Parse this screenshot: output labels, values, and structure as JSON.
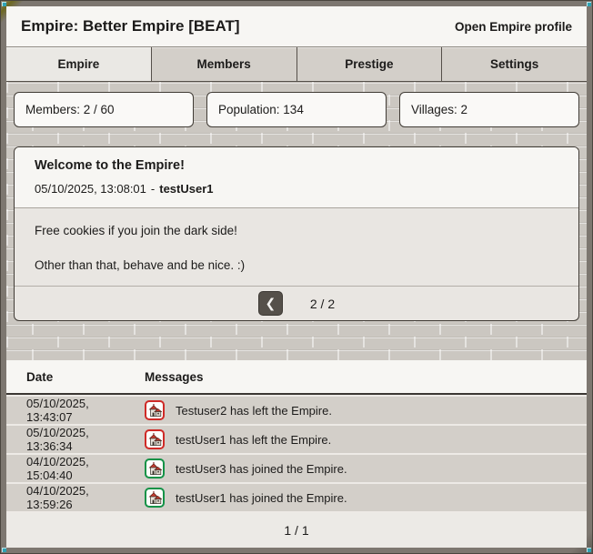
{
  "window": {
    "title": "Empire: Better Empire [BEAT]",
    "profile_link": "Open Empire profile"
  },
  "tabs": [
    {
      "label": "Empire",
      "active": true
    },
    {
      "label": "Members",
      "active": false
    },
    {
      "label": "Prestige",
      "active": false
    },
    {
      "label": "Settings",
      "active": false
    }
  ],
  "stats": [
    {
      "label": "Members: 2 / 60"
    },
    {
      "label": "Population: 134"
    },
    {
      "label": "Villages: 2"
    }
  ],
  "announcement": {
    "title": "Welcome to the Empire!",
    "timestamp": "05/10/2025, 13:08:01",
    "separator": "-",
    "author": "testUser1",
    "line1": "Free cookies if you join the dark side!",
    "line2": "Other than that, behave and be nice. :)",
    "pagination": {
      "prev_icon": "❮",
      "page": "2 / 2"
    }
  },
  "log": {
    "columns": {
      "date": "Date",
      "messages": "Messages"
    },
    "rows": [
      {
        "date": "05/10/2025, 13:43:07",
        "variant": "left",
        "text": "Testuser2 has left the Empire."
      },
      {
        "date": "05/10/2025, 13:36:34",
        "variant": "left",
        "text": "testUser1 has left the Empire."
      },
      {
        "date": "04/10/2025, 15:04:40",
        "variant": "joined",
        "text": "testUser3 has joined the Empire."
      },
      {
        "date": "04/10/2025, 13:59:26",
        "variant": "joined",
        "text": "testUser1 has joined the Empire."
      }
    ],
    "pagination": "1 / 1"
  },
  "colors": {
    "left_event_border": "#cf2a27",
    "joined_event_border": "#149247",
    "frame": "#7d7770",
    "resize_handle": "#2fa3b4",
    "brick_background": "#cbc7c1",
    "panel_background": "#f7f6f3",
    "row_background": "#d3cfc9",
    "pagination_button": "#55504a"
  }
}
